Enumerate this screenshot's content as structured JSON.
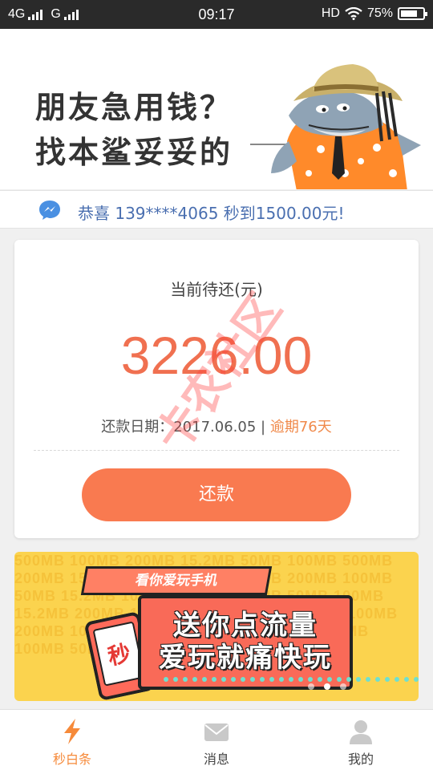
{
  "status_bar": {
    "network_1": "4G",
    "network_2": "G",
    "time": "09:17",
    "hd": "HD",
    "battery_text": "75%",
    "battery_level": 0.75
  },
  "banner": {
    "line1": "朋友急用钱？",
    "line2": "找本鲨妥妥的",
    "mascot_icon": "shark-mascot-icon"
  },
  "ticker": {
    "icon": "message-bubble-icon",
    "text": "恭喜 139****4065 秒到1500.00元!"
  },
  "repay_card": {
    "label": "当前待还(元)",
    "amount": "3226.00",
    "due_label": "还款日期：",
    "due_date": "2017.06.05",
    "separator": "|",
    "overdue_text": "逾期76天",
    "button_label": "还款",
    "accent_color": "#f07050",
    "button_color": "#f97a50"
  },
  "watermark": {
    "text": "卡农社区"
  },
  "promo": {
    "tag": "看你爱玩手机",
    "line1": "送你点流量",
    "line2": "爱玩就痛快玩",
    "phone_char": "秒",
    "background_text": "500MB 100MB 200MB 15.2MB 50MB 100MB 500MB 200MB 15.2MB 50MB 100MB 500MB 200MB 100MB 50MB 15.2MB 100MB 200MB 500MB 50MB 100MB 15.2MB 200MB 100MB 500MB 50MB 15.2MB 100MB 200MB 100 50MB 500MB 100MB 15.2MB 200MB 100MB 50MB 500MB 100MB 15.2MB 200MB",
    "bg_color": "#fbd34e"
  },
  "bottom_nav": {
    "items": [
      {
        "label": "秒白条",
        "icon": "lightning-icon",
        "active": true
      },
      {
        "label": "消息",
        "icon": "envelope-icon",
        "active": false
      },
      {
        "label": "我的",
        "icon": "user-icon",
        "active": false
      }
    ],
    "active_color": "#f68a3a"
  }
}
